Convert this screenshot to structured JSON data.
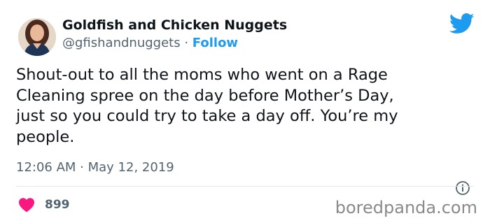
{
  "author": {
    "name": "Goldfish and Chicken Nuggets",
    "handle": "@gfishandnuggets",
    "separator": "·",
    "follow_label": "Follow",
    "avatar_icon": "user-avatar"
  },
  "tweet": {
    "lines": [
      "Shout-out to all the moms who went on a Rage",
      "Cleaning spree on the day before Mother’s Day,",
      "just so you could try to take a day off.  You’re my",
      "people."
    ],
    "timestamp": "12:06 AM · May 12, 2019"
  },
  "actions": {
    "like_count": "899",
    "like_icon": "heart-icon",
    "info_icon": "info-icon"
  },
  "branding": {
    "platform_icon": "twitter-bird-icon",
    "watermark": "boredpanda.com"
  },
  "colors": {
    "accent": "#1d9bf0",
    "heart": "#f91880",
    "secondary_text": "#536471",
    "primary_text": "#0f1419"
  }
}
